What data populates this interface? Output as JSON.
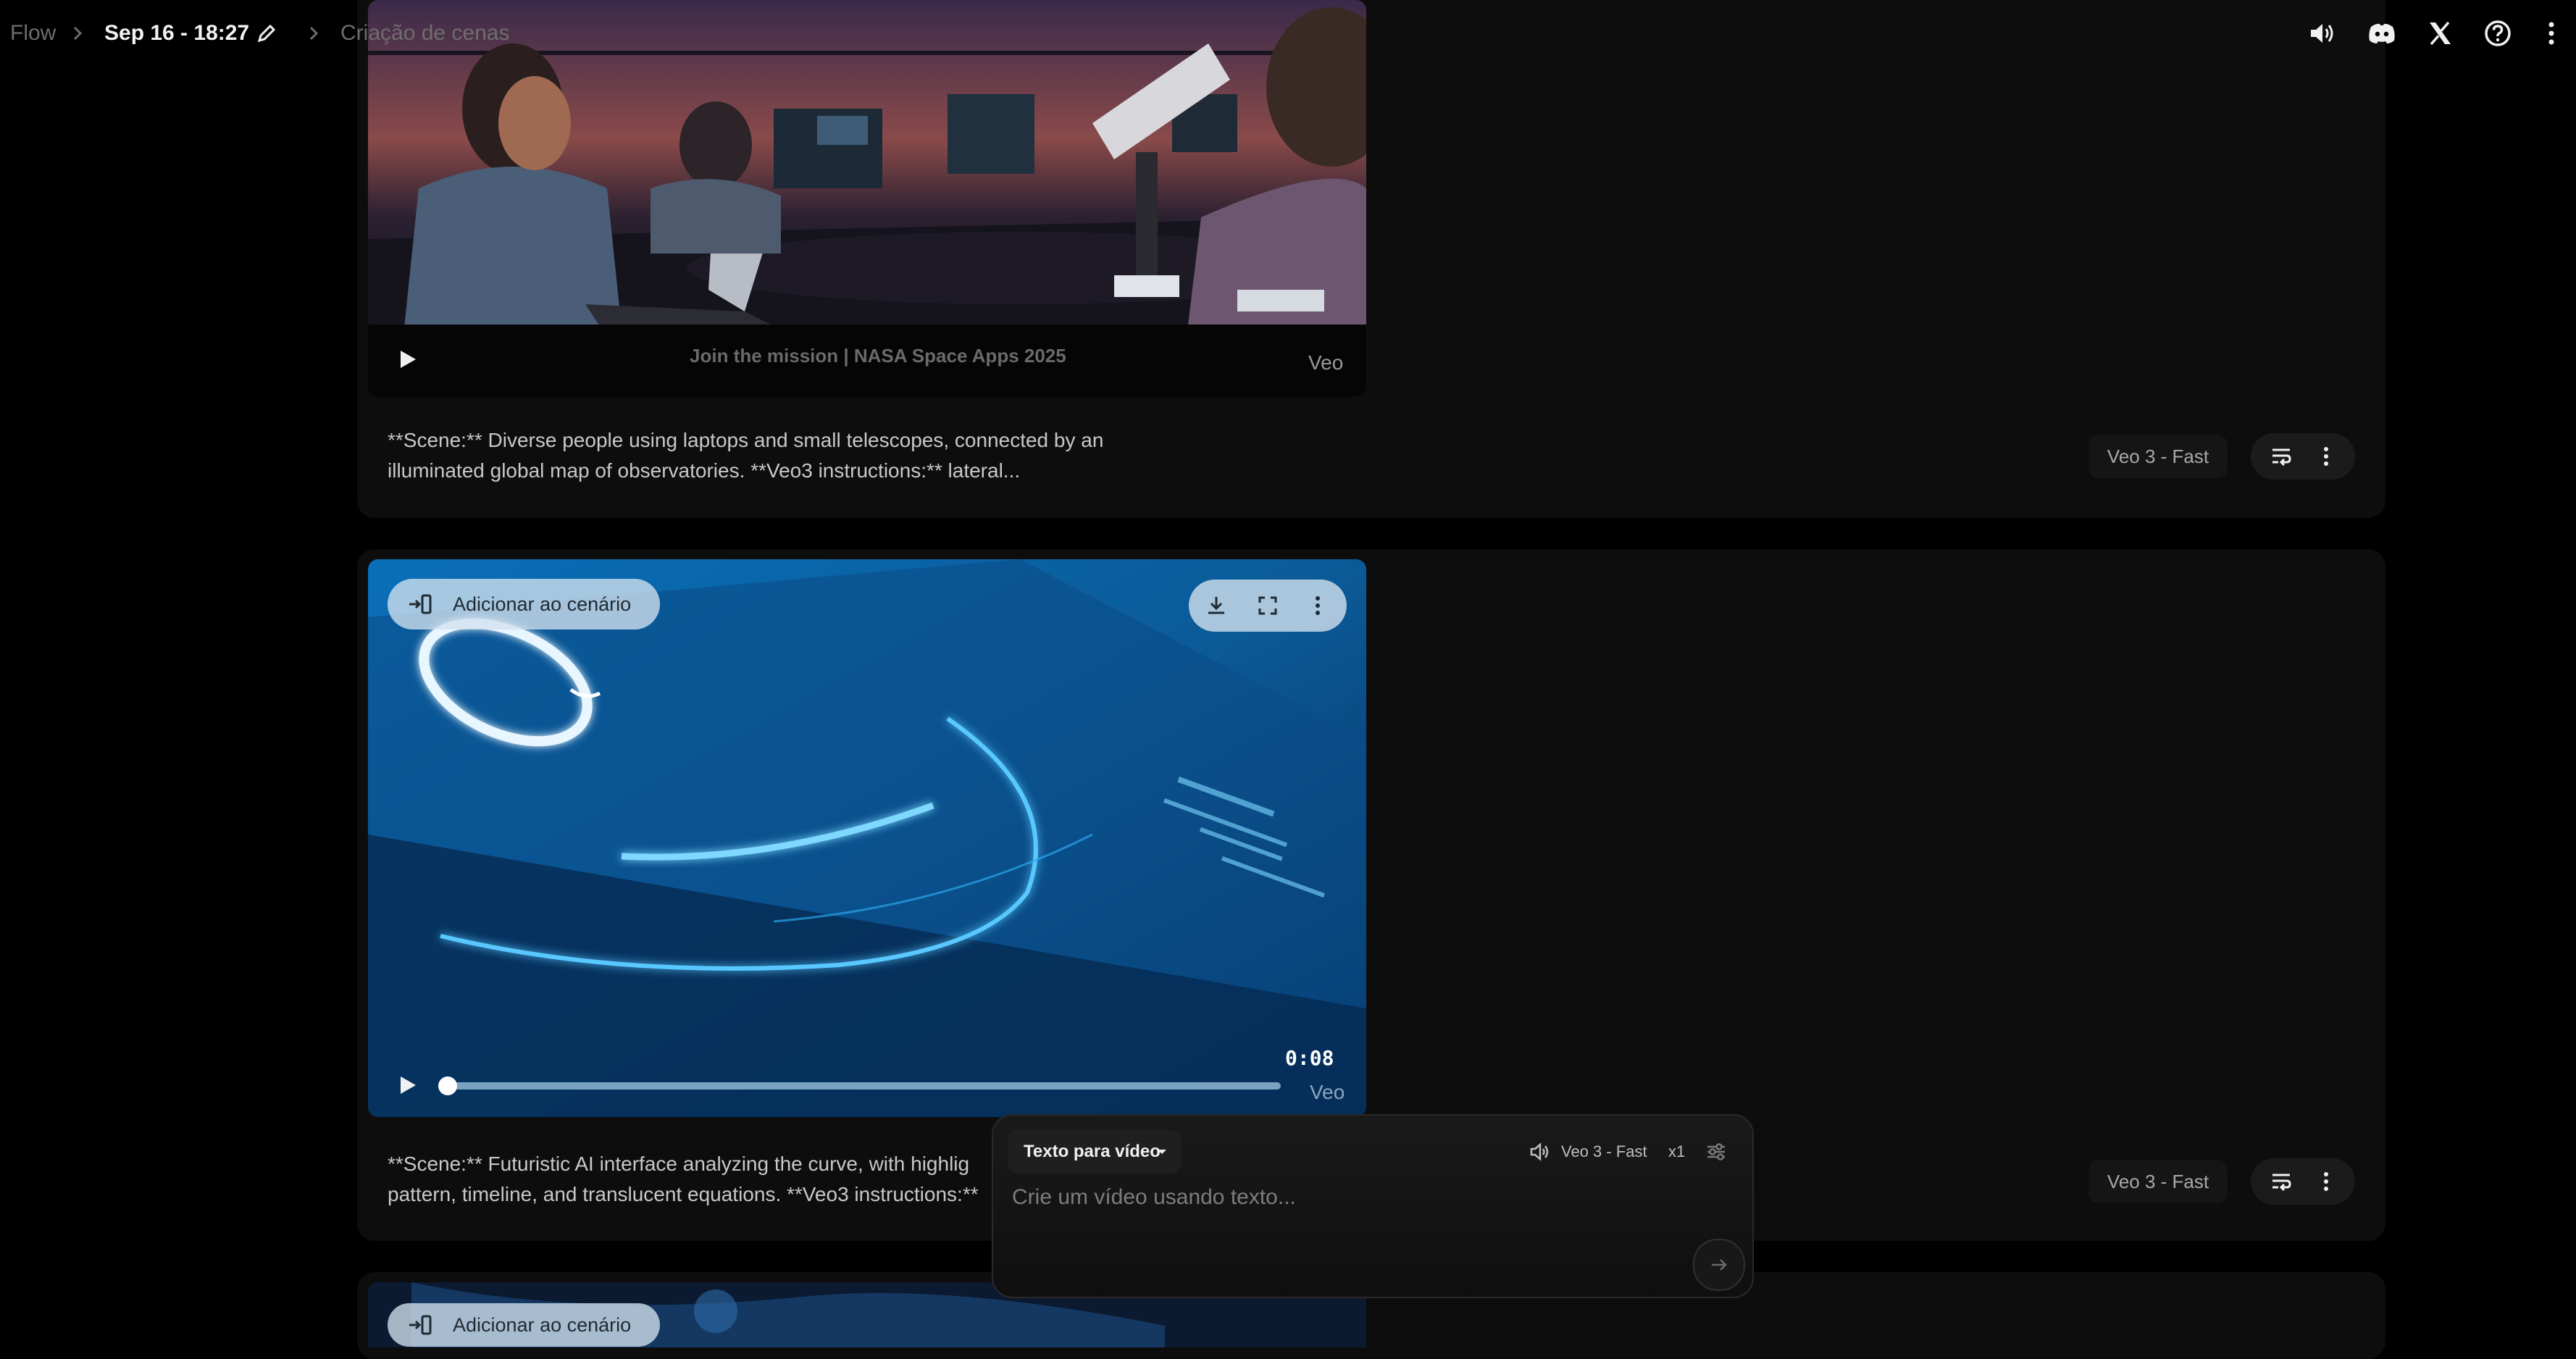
{
  "breadcrumb": {
    "root": "Flow",
    "project": "Sep 16 - 18:27",
    "current": "Criação de cenas"
  },
  "top_icons": [
    "volume-icon",
    "discord-icon",
    "x-logo-icon",
    "help-icon",
    "more-vert-icon"
  ],
  "cards": [
    {
      "video_caption": "Join the mission | NASA Space Apps 2025",
      "watermark": "Veo",
      "prompt": "**Scene:** Diverse people using laptops and small telescopes, connected by an illuminated global map of observatories. **Veo3 instructions:** lateral...",
      "model": "Veo 3 - Fast"
    },
    {
      "add_label": "Adicionar ao cenário",
      "timestamp": "0:08",
      "progress": 0.0,
      "watermark": "Veo",
      "prompt_line1": "**Scene:** Futuristic AI interface analyzing the curve, with highlig",
      "prompt_line2": "pattern, timeline, and translucent equations. **Veo3 instructions:**",
      "model": "Veo 3 - Fast"
    },
    {
      "add_label": "Adicionar ao cenário"
    }
  ],
  "composer": {
    "mode": "Texto para vídeo",
    "model": "Veo 3 - Fast",
    "count": "x1",
    "placeholder": "Crie um vídeo usando texto..."
  },
  "colors": {
    "background": "#000000",
    "card": "#0d0d0d",
    "video_blue": "#0a5fa8",
    "overlay_chip": "#d2e2ee"
  }
}
